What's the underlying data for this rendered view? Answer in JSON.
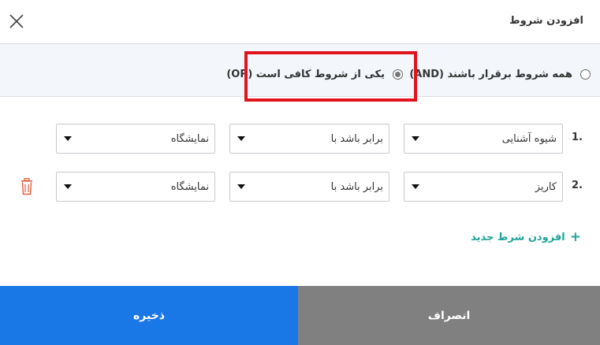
{
  "dialog": {
    "title": "افزودن شروط"
  },
  "match_mode": {
    "all_label": "همه شروط برقرار باشند (AND)",
    "any_label": "یکی از شروط کافی است (OR)",
    "selected": "any"
  },
  "conditions": [
    {
      "index": "1.",
      "field": "شیوه آشنایی",
      "operator": "برابر باشد با",
      "value": "نمایشگاه"
    },
    {
      "index": "2.",
      "field": "کاریز",
      "operator": "برابر باشد با",
      "value": "نمایشگاه"
    }
  ],
  "add_condition_label": "افزودن شرط جدید",
  "actions": {
    "save_label": "ذخیره",
    "cancel_label": "انصراف"
  },
  "colors": {
    "primary": "#1a78e6",
    "secondary": "#808080",
    "accent": "#1fa49a",
    "highlight": "#e0141e",
    "danger": "#e05a3c"
  }
}
